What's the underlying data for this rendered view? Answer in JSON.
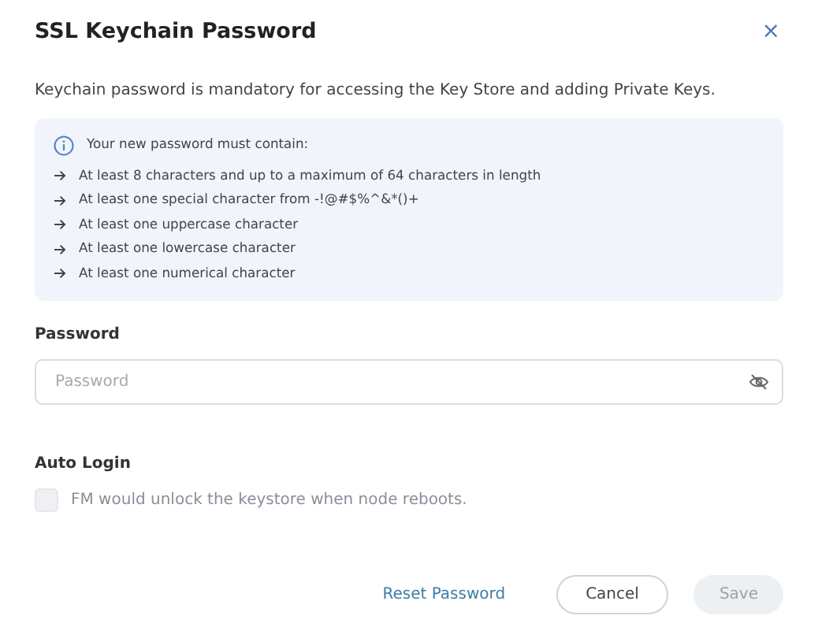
{
  "dialog": {
    "title": "SSL Keychain Password",
    "close": "×"
  },
  "description": "Keychain password is mandatory for accessing the Key Store and adding Private Keys.",
  "requirements": {
    "heading": "Your new password must contain:",
    "items": [
      "At least 8 characters and up to a maximum of 64 characters in length",
      "At least one special character from -!@#$%^&*()+",
      "At least one uppercase character",
      "At least one lowercase character",
      "At least one numerical character"
    ]
  },
  "password": {
    "label": "Password",
    "placeholder": "Password"
  },
  "auto_login": {
    "label": "Auto Login",
    "option": "FM would unlock the keystore when node reboots.",
    "checked": false,
    "disabled": true
  },
  "buttons": [
    {
      "kind": "link",
      "label": "Reset Password",
      "disabled": false
    },
    {
      "kind": "outline",
      "label": "Cancel",
      "disabled": false
    },
    {
      "kind": "primary",
      "label": "Save",
      "disabled": true
    }
  ]
}
